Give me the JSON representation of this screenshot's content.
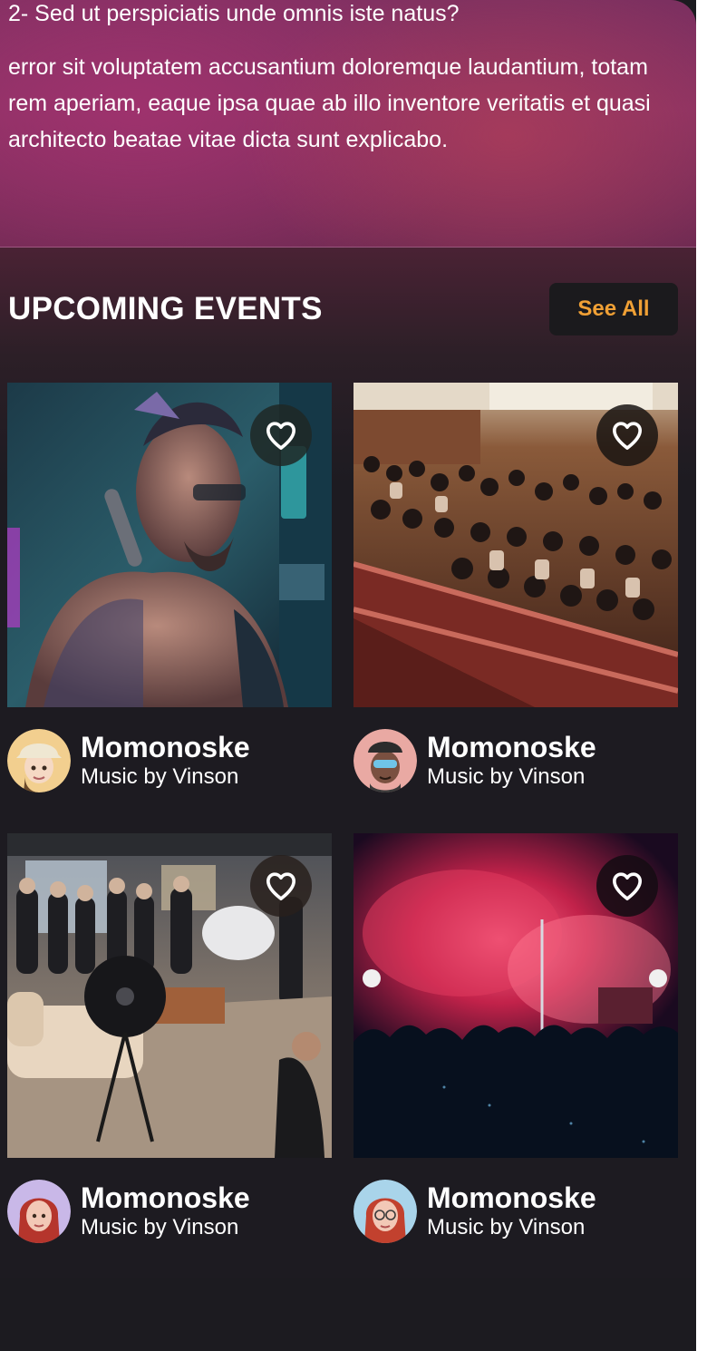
{
  "faq": {
    "question": "2- Sed ut perspiciatis unde omnis iste natus?",
    "answer": " error sit voluptatem accusantium doloremque laudantium, totam rem aperiam, eaque ipsa quae ab illo inventore veritatis et quasi architecto beatae vitae dicta sunt explicabo."
  },
  "events": {
    "heading": "UPCOMING EVENTS",
    "see_all_label": "See All",
    "items": [
      {
        "title": "Momonoske",
        "subtitle": "Music by Vinson",
        "image": "cyberpunk-tattooed-performer-photo",
        "avatar": "memoji-bucket-hat"
      },
      {
        "title": "Momonoske",
        "subtitle": "Music by Vinson",
        "image": "auditorium-audience-photo",
        "avatar": "memoji-sunglasses-cap"
      },
      {
        "title": "Momonoske",
        "subtitle": "Music by Vinson",
        "image": "photo-studio-shoot-photo",
        "avatar": "memoji-red-hair"
      },
      {
        "title": "Momonoske",
        "subtitle": "Music by Vinson",
        "image": "concert-red-smoke-photo",
        "avatar": "memoji-red-hair-glasses"
      }
    ]
  },
  "colors": {
    "accent": "#f0a035",
    "background": "#1d1b21",
    "faq_card": "#8a3264"
  },
  "icons": {
    "favorite": "heart-outline-icon"
  }
}
